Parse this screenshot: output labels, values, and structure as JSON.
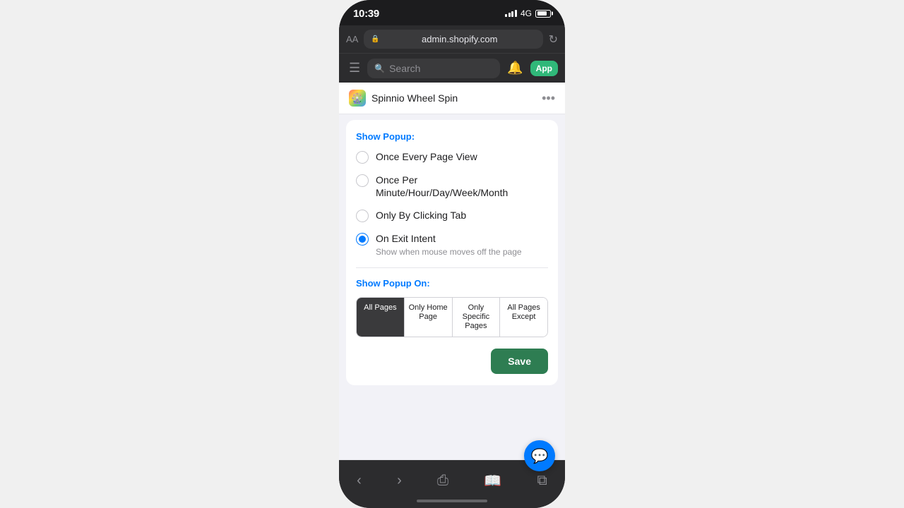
{
  "status": {
    "time": "10:39",
    "signal": "4G",
    "address": "admin.shopify.com"
  },
  "browser": {
    "aa": "AA",
    "reload": "↻"
  },
  "toolbar": {
    "search_placeholder": "Search"
  },
  "app": {
    "name": "Spinnio Wheel Spin",
    "badge": "App"
  },
  "popup_section": {
    "title": "Show Popup:",
    "options": [
      {
        "label": "Once Every Page View",
        "sublabel": "",
        "selected": false
      },
      {
        "label": "Once Per Minute/Hour/Day/Week/Month",
        "sublabel": "",
        "selected": false
      },
      {
        "label": "Only By Clicking Tab",
        "sublabel": "",
        "selected": false
      },
      {
        "label": "On Exit Intent",
        "sublabel": "Show when mouse moves off the page",
        "selected": true
      }
    ]
  },
  "show_on_section": {
    "title": "Show Popup On:",
    "tabs": [
      {
        "label": "All Pages",
        "active": true
      },
      {
        "label": "Only Home Page",
        "active": false
      },
      {
        "label": "Only Specific Pages",
        "active": false
      },
      {
        "label": "All Pages Except",
        "active": false
      }
    ]
  },
  "save_button": "Save"
}
